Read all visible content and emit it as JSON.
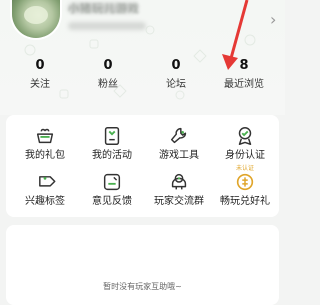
{
  "header": {
    "username": "小猪玩儿游戏",
    "subtitle": ""
  },
  "stats": [
    {
      "value": "0",
      "label": "关注"
    },
    {
      "value": "0",
      "label": "粉丝"
    },
    {
      "value": "0",
      "label": "论坛"
    },
    {
      "value": "8",
      "label": "最近浏览"
    }
  ],
  "grid": {
    "row1": [
      {
        "label": "我的礼包",
        "icon": "gift-basket-icon"
      },
      {
        "label": "我的活动",
        "icon": "bookmark-icon"
      },
      {
        "label": "游戏工具",
        "icon": "wrench-icon"
      },
      {
        "label": "身份认证",
        "icon": "badge-person-icon",
        "badge": "未认证"
      }
    ],
    "row2": [
      {
        "label": "兴趣标签",
        "icon": "tag-icon"
      },
      {
        "label": "意见反馈",
        "icon": "feedback-edit-icon"
      },
      {
        "label": "玩家交流群",
        "icon": "group-chat-icon"
      },
      {
        "label": "畅玩兑好礼",
        "icon": "coin-icon"
      }
    ]
  },
  "empty_message": "暂时没有玩家互助哦~",
  "colors": {
    "accent": "#4ab04f",
    "badge": "#e0a52a",
    "annotation": "#e53935"
  }
}
